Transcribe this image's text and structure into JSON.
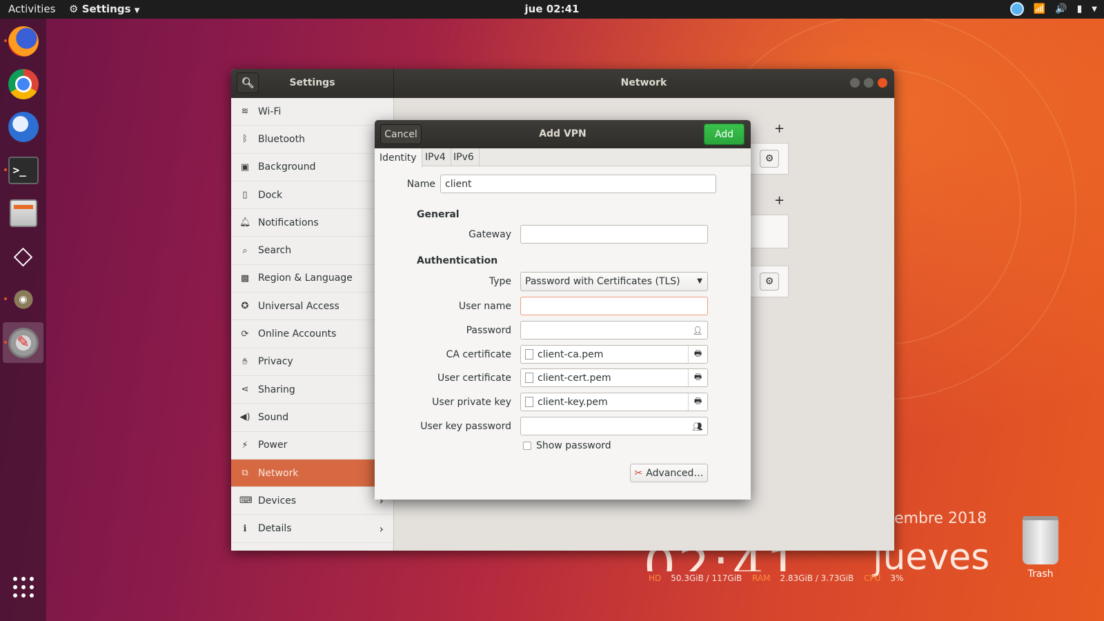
{
  "topbar": {
    "activities": "Activities",
    "app_menu": "Settings",
    "clock": "jue 02:41"
  },
  "dock": {
    "items": [
      {
        "name": "firefox-icon"
      },
      {
        "name": "chrome-icon"
      },
      {
        "name": "thunderbird-icon"
      },
      {
        "name": "terminal-icon"
      },
      {
        "name": "files-icon"
      },
      {
        "name": "unity-icon"
      },
      {
        "name": "gimp-icon"
      },
      {
        "name": "settings-icon"
      }
    ]
  },
  "settings_window": {
    "left_title": "Settings",
    "right_title": "Network",
    "sidebar": [
      {
        "label": "Wi-Fi",
        "icon": "wifi-icon"
      },
      {
        "label": "Bluetooth",
        "icon": "bluetooth-icon"
      },
      {
        "label": "Background",
        "icon": "background-icon"
      },
      {
        "label": "Dock",
        "icon": "dock-icon"
      },
      {
        "label": "Notifications",
        "icon": "bell-icon"
      },
      {
        "label": "Search",
        "icon": "search-icon"
      },
      {
        "label": "Region & Language",
        "icon": "camera-icon"
      },
      {
        "label": "Universal Access",
        "icon": "accessibility-icon"
      },
      {
        "label": "Online Accounts",
        "icon": "accounts-icon"
      },
      {
        "label": "Privacy",
        "icon": "hand-icon"
      },
      {
        "label": "Sharing",
        "icon": "share-icon"
      },
      {
        "label": "Sound",
        "icon": "speaker-icon"
      },
      {
        "label": "Power",
        "icon": "power-icon"
      },
      {
        "label": "Network",
        "icon": "network-icon",
        "selected": true
      },
      {
        "label": "Devices",
        "icon": "devices-icon",
        "chevron": true
      },
      {
        "label": "Details",
        "icon": "info-icon",
        "chevron": true
      }
    ]
  },
  "dialog": {
    "title": "Add VPN",
    "cancel": "Cancel",
    "add": "Add",
    "tabs": [
      "Identity",
      "IPv4",
      "IPv6"
    ],
    "name_label": "Name",
    "name_value": "client",
    "general_header": "General",
    "gateway_label": "Gateway",
    "gateway_value": "",
    "auth_header": "Authentication",
    "type_label": "Type",
    "type_value": "Password with Certificates (TLS)",
    "username_label": "User name",
    "username_value": "",
    "password_label": "Password",
    "ca_label": "CA certificate",
    "ca_value": "client-ca.pem",
    "user_cert_label": "User certificate",
    "user_cert_value": "client-cert.pem",
    "private_key_label": "User private key",
    "private_key_value": "client-key.pem",
    "key_password_label": "User key password",
    "show_password": "Show password",
    "advanced": "Advanced…"
  },
  "desktop": {
    "date_fragment": "embre 2018",
    "big_time": "02:41",
    "day": "jueves",
    "stats": {
      "hd_label": "HD",
      "hd_value": "50.3GiB / 117GiB",
      "ram_label": "RAM",
      "ram_value": "2.83GiB / 3.73GiB",
      "cpu_label": "CPU",
      "cpu_value": "3%"
    },
    "trash": "Trash"
  },
  "colors": {
    "accent": "#e95420",
    "selected_row": "#d76942",
    "add_button": "#2fb143"
  }
}
